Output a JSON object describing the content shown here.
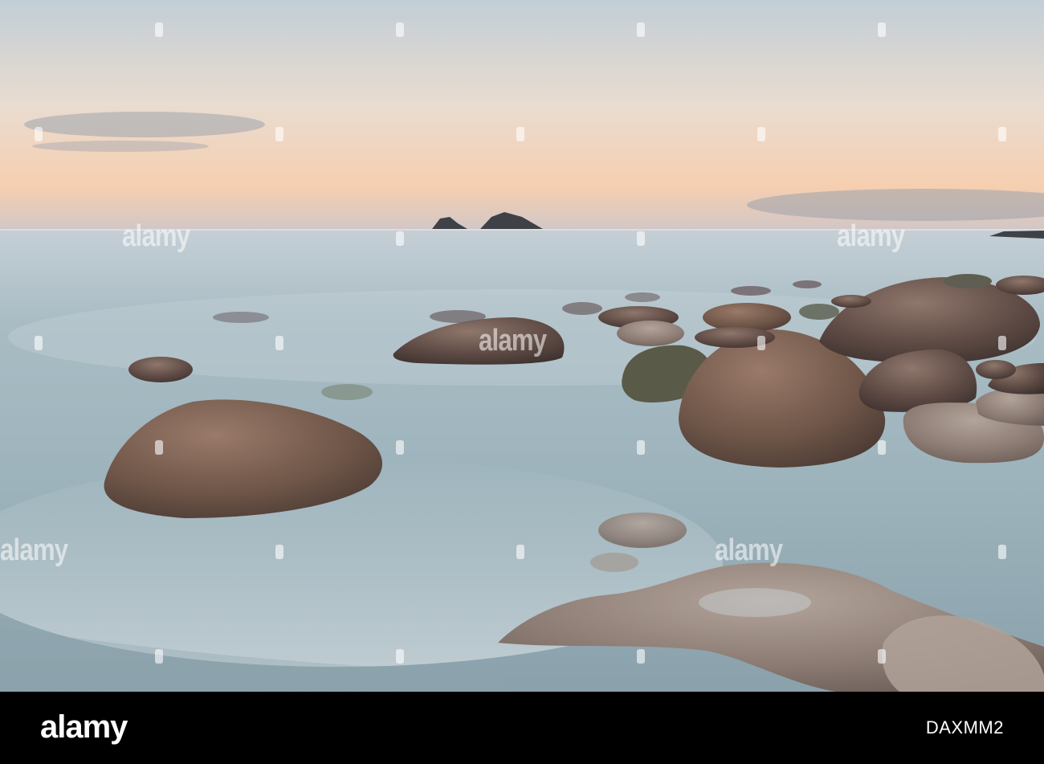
{
  "watermark": {
    "text": "alamy"
  },
  "footer": {
    "brand": "alamy",
    "image_reference": "DAXMM2"
  },
  "colors": {
    "sky_top": "#b9c8d4",
    "sky_horizon": "#f3c9a4",
    "sea": "#9fb4bd",
    "boulder": "#6d5650",
    "bar": "#000000"
  }
}
